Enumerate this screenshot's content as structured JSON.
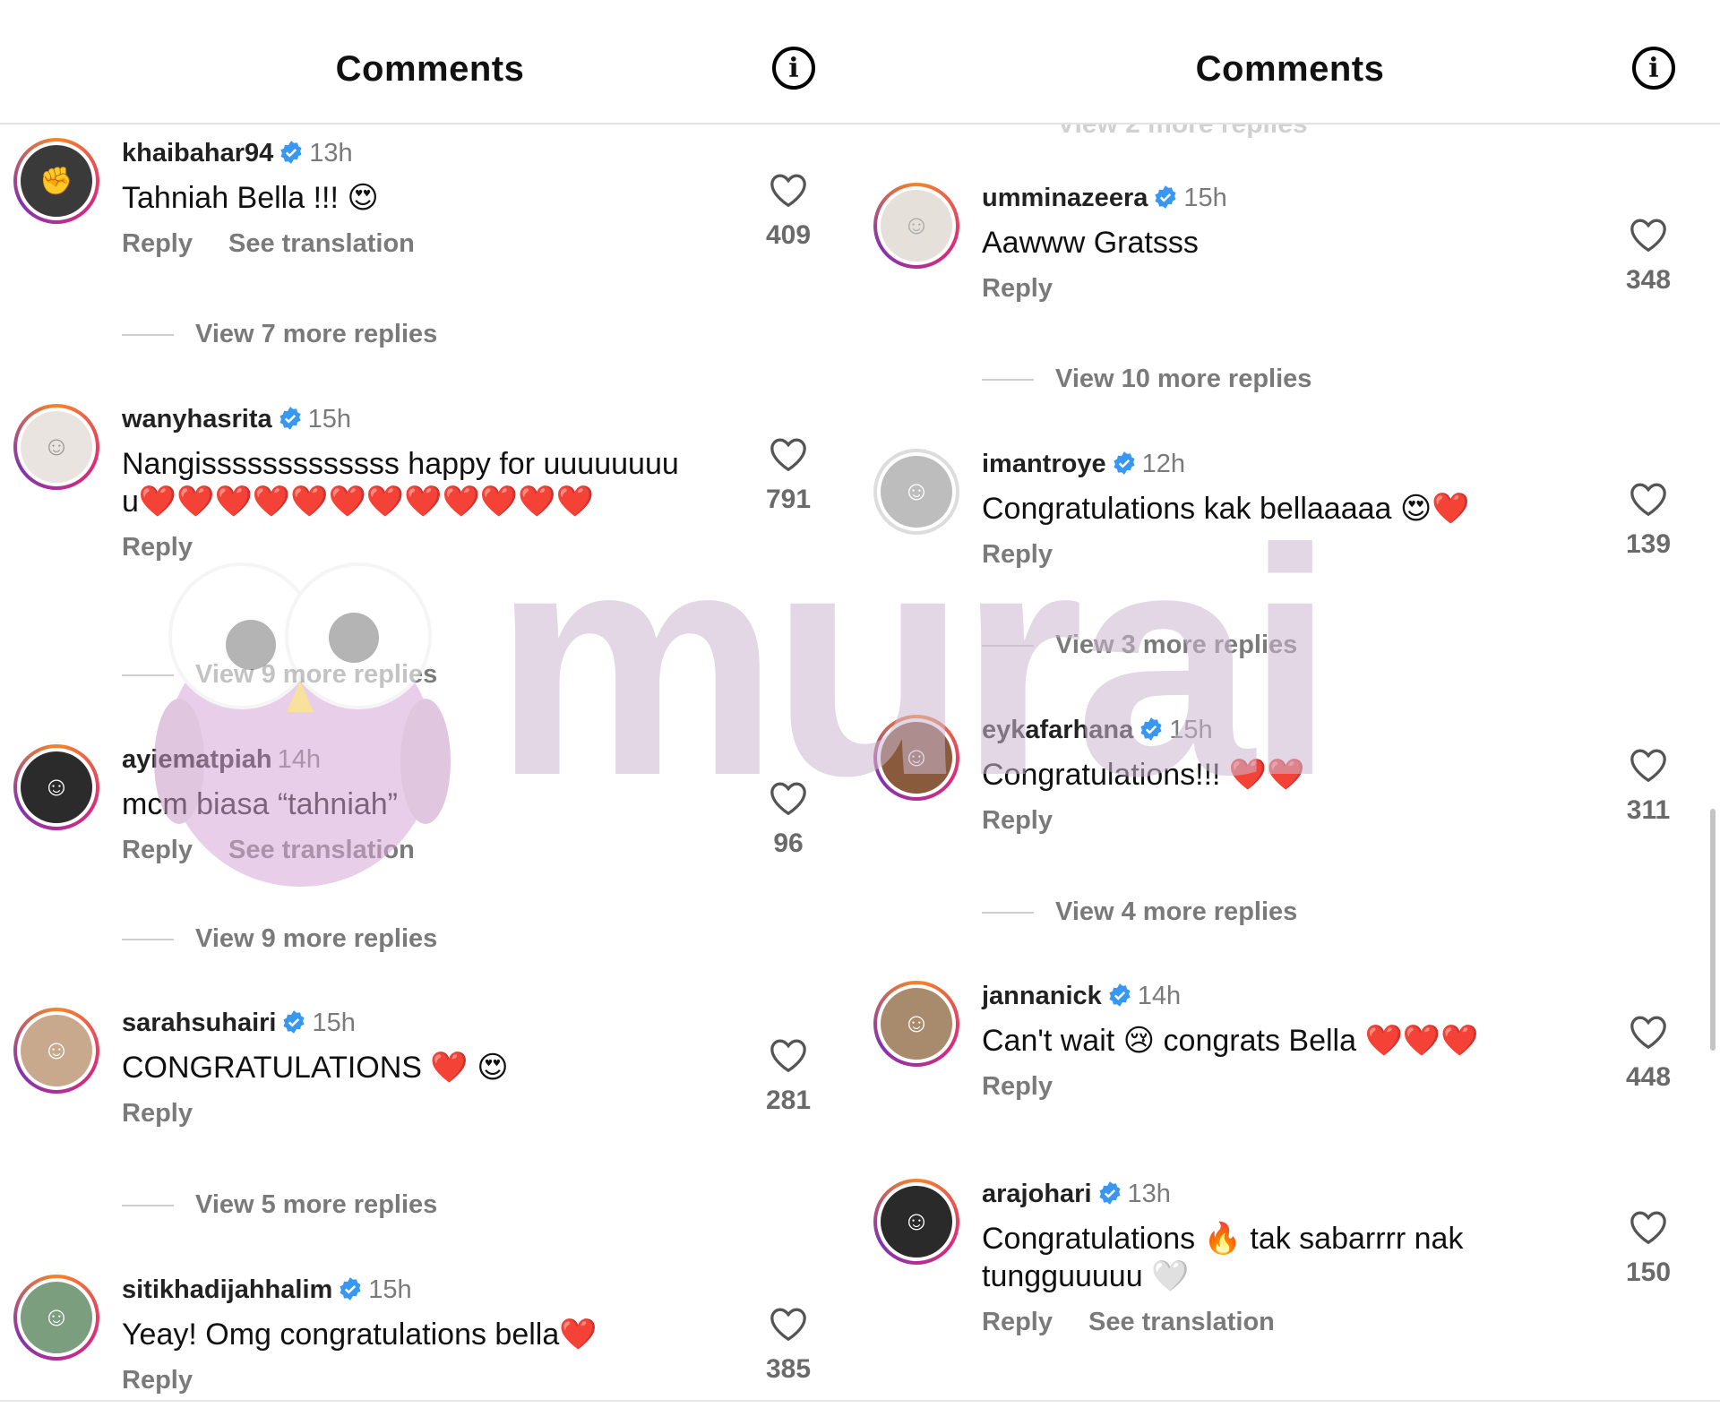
{
  "left": {
    "title": "Comments",
    "comments": [
      {
        "user": "khaibahar94",
        "verified": true,
        "time": "13h",
        "text": "Tahniah Bella !!! 😍",
        "actions": [
          "Reply",
          "See translation"
        ],
        "likes": "409",
        "replies": "View 7 more replies"
      },
      {
        "user": "wanyhasrita",
        "verified": true,
        "time": "15h",
        "text": "Nangisssssssssssss happy for uuuuuuuuu❤️❤️❤️❤️❤️❤️❤️❤️❤️❤️❤️❤️",
        "actions": [
          "Reply"
        ],
        "likes": "791",
        "replies": "View 9 more replies"
      },
      {
        "user": "ayiematpiah",
        "verified": false,
        "time": "14h",
        "text": "mcm biasa “tahniah”",
        "actions": [
          "Reply",
          "See translation"
        ],
        "likes": "96",
        "replies": "View 9 more replies"
      },
      {
        "user": "sarahsuhairi",
        "verified": true,
        "time": "15h",
        "text": "CONGRATULATIONS ❤️ 😍",
        "actions": [
          "Reply"
        ],
        "likes": "281",
        "replies": "View 5 more replies"
      },
      {
        "user": "sitikhadijahhalim",
        "verified": true,
        "time": "15h",
        "text": "Yeay! Omg congratulations bella❤️",
        "actions": [
          "Reply"
        ],
        "likes": "385",
        "replies": ""
      }
    ]
  },
  "right": {
    "title": "Comments",
    "ghost_text": "View 2 more replies",
    "comments": [
      {
        "user": "umminazeera",
        "verified": true,
        "time": "15h",
        "text": "Aawww Gratsss",
        "actions": [
          "Reply"
        ],
        "likes": "348",
        "replies": "View 10 more replies"
      },
      {
        "user": "imantroye",
        "verified": true,
        "time": "12h",
        "text": "Congratulations kak bellaaaaa 😍❤️",
        "actions": [
          "Reply"
        ],
        "likes": "139",
        "replies": "View 3 more replies"
      },
      {
        "user": "eykafarhana",
        "verified": true,
        "time": "15h",
        "text": "Congratulations!!! ❤️❤️",
        "actions": [
          "Reply"
        ],
        "likes": "311",
        "replies": "View 4 more replies"
      },
      {
        "user": "jannanick",
        "verified": true,
        "time": "14h",
        "text": "Can't wait 😢 congrats Bella ❤️❤️❤️",
        "actions": [
          "Reply"
        ],
        "likes": "448",
        "replies": ""
      },
      {
        "user": "arajohari",
        "verified": true,
        "time": "13h",
        "text": "Congratulations 🔥 tak sabarrrr nak tungguuuuu 🤍",
        "actions": [
          "Reply",
          "See translation"
        ],
        "likes": "150",
        "replies": ""
      }
    ]
  },
  "watermark": "murai",
  "colors": {
    "verified": "#3897f0",
    "heart_red": "#e5202e",
    "muted": "#7a7a7a"
  }
}
